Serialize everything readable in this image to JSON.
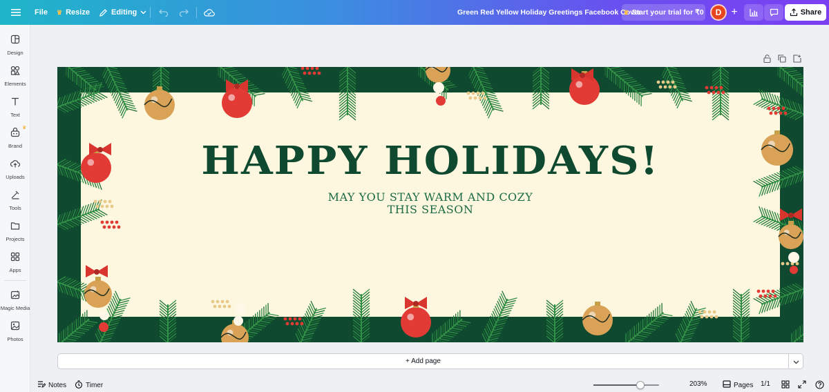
{
  "topbar": {
    "file": "File",
    "resize": "Resize",
    "editing": "Editing",
    "doc_title": "Green Red Yellow Holiday Greetings Facebook Cover",
    "trial": "Start your trial for ₹0",
    "avatar_initial": "D",
    "share": "Share",
    "icons": [
      "menu-icon",
      "crown-icon",
      "pencil-icon",
      "chevron-down-icon",
      "undo-icon",
      "redo-icon",
      "cloud-save-icon",
      "plus-icon",
      "analytics-icon",
      "comment-icon",
      "share-upload-icon"
    ]
  },
  "sidebar": {
    "items": [
      {
        "label": "Design",
        "icon": "design-icon"
      },
      {
        "label": "Elements",
        "icon": "elements-icon"
      },
      {
        "label": "Text",
        "icon": "text-icon"
      },
      {
        "label": "Brand",
        "icon": "brand-icon"
      },
      {
        "label": "Uploads",
        "icon": "uploads-icon"
      },
      {
        "label": "Tools",
        "icon": "tools-icon"
      },
      {
        "label": "Projects",
        "icon": "projects-icon"
      },
      {
        "label": "Apps",
        "icon": "apps-icon"
      },
      {
        "label": "Magic Media",
        "icon": "magic-media-icon"
      },
      {
        "label": "Photos",
        "icon": "photos-icon"
      }
    ]
  },
  "canvas_tools": [
    "lock-icon",
    "duplicate-icon",
    "add-page-icon"
  ],
  "design": {
    "headline": "HAPPY HOLIDAYS!",
    "subline_1": "MAY YOU STAY WARM AND COZY",
    "subline_2": "THIS SEASON",
    "colors": {
      "frame": "#0f4a30",
      "paper": "#fdf7df",
      "ornament_red": "#e23b36",
      "ornament_gold": "#d9a257",
      "pine": "#2f8f45"
    }
  },
  "add_page": "+ Add page",
  "bottombar": {
    "notes": "Notes",
    "timer": "Timer",
    "zoom": "203%",
    "zoom_fraction": 0.72,
    "pages": "Pages",
    "page_count": "1/1"
  },
  "accent_gradient": [
    "#1fb5c9",
    "#7b3ff2"
  ]
}
